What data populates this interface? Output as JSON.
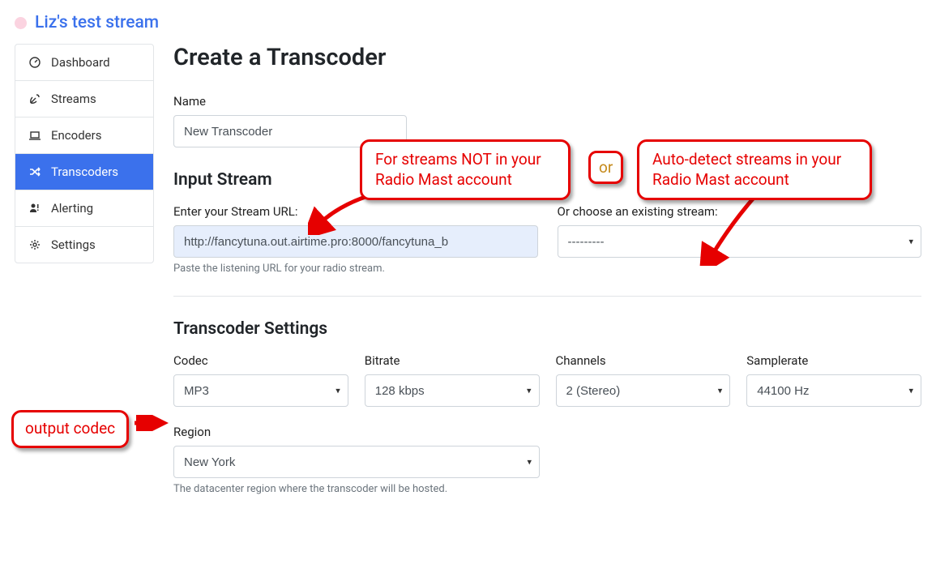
{
  "header": {
    "stream_title": "Liz's test stream"
  },
  "sidebar": {
    "items": [
      {
        "label": "Dashboard"
      },
      {
        "label": "Streams"
      },
      {
        "label": "Encoders"
      },
      {
        "label": "Transcoders"
      },
      {
        "label": "Alerting"
      },
      {
        "label": "Settings"
      }
    ]
  },
  "main": {
    "heading": "Create a Transcoder",
    "name_label": "Name",
    "name_value": "New Transcoder",
    "input_stream_heading": "Input Stream",
    "stream_url_label": "Enter your Stream URL:",
    "stream_url_value": "http://fancytuna.out.airtime.pro:8000/fancytuna_b",
    "stream_url_hint": "Paste the listening URL for your radio stream.",
    "existing_label": "Or choose an existing stream:",
    "existing_value": "---------",
    "settings_heading": "Transcoder Settings",
    "codec_label": "Codec",
    "codec_value": "MP3",
    "bitrate_label": "Bitrate",
    "bitrate_value": "128 kbps",
    "channels_label": "Channels",
    "channels_value": "2 (Stereo)",
    "samplerate_label": "Samplerate",
    "samplerate_value": "44100 Hz",
    "region_label": "Region",
    "region_value": "New York",
    "region_hint": "The datacenter region where the transcoder will be hosted."
  },
  "annotations": {
    "callout_left": "For streams NOT in your Radio Mast account",
    "or": "or",
    "callout_right": "Auto-detect streams in your Radio Mast account",
    "output_codec": "output codec"
  }
}
